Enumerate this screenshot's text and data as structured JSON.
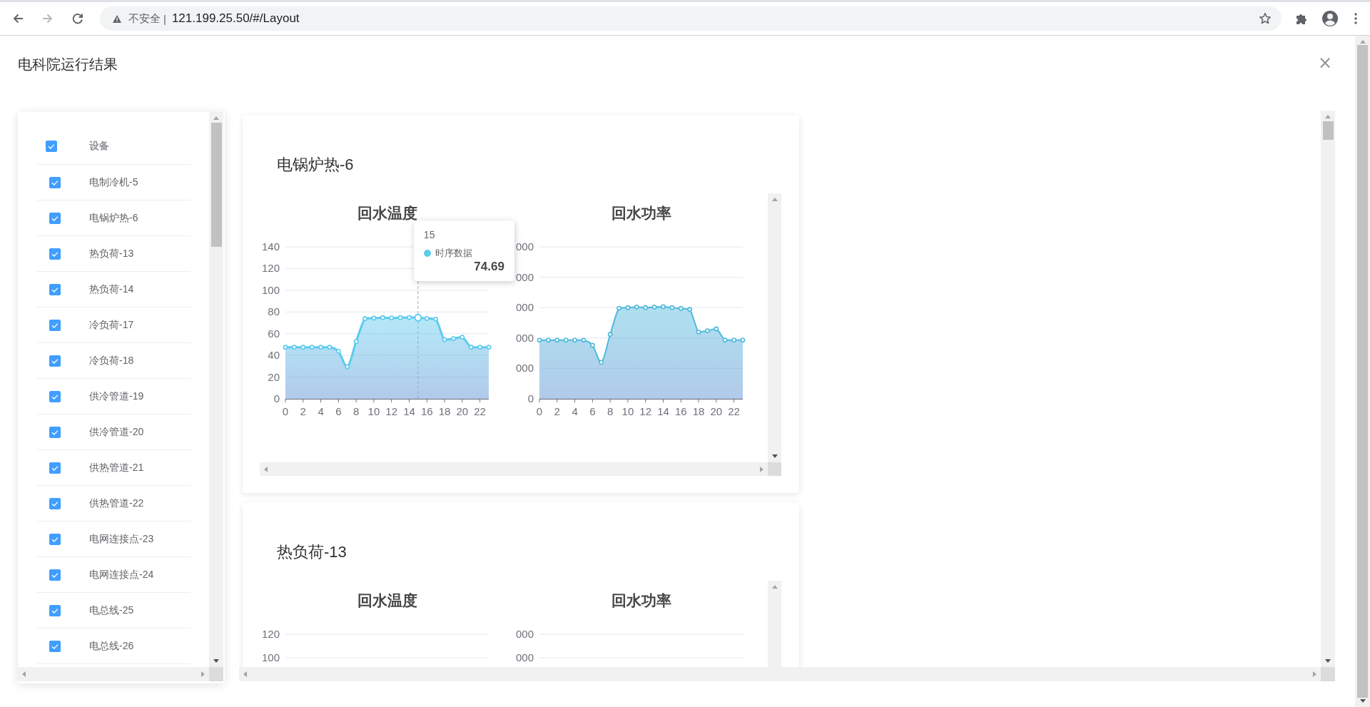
{
  "browser": {
    "nav_buttons": [
      {
        "kind": "back",
        "disabled": false
      },
      {
        "kind": "forward",
        "disabled": true
      },
      {
        "kind": "reload",
        "disabled": false
      }
    ],
    "security_label": "不安全",
    "separator": "|",
    "url": "121.199.25.50/#/Layout"
  },
  "dialog": {
    "title": "电科院运行结果",
    "close": "×"
  },
  "device_table": {
    "header": {
      "label": "设备",
      "checked": true
    },
    "rows": [
      {
        "label": "电制冷机-5",
        "checked": true
      },
      {
        "label": "电锅炉热-6",
        "checked": true
      },
      {
        "label": "热负荷-13",
        "checked": true
      },
      {
        "label": "热负荷-14",
        "checked": true
      },
      {
        "label": "冷负荷-17",
        "checked": true
      },
      {
        "label": "冷负荷-18",
        "checked": true
      },
      {
        "label": "供冷管道-19",
        "checked": true
      },
      {
        "label": "供冷管道-20",
        "checked": true
      },
      {
        "label": "供热管道-21",
        "checked": true
      },
      {
        "label": "供热管道-22",
        "checked": true
      },
      {
        "label": "电网连接点-23",
        "checked": true
      },
      {
        "label": "电网连接点-24",
        "checked": true
      },
      {
        "label": "电总线-25",
        "checked": true
      },
      {
        "label": "电总线-26",
        "checked": true
      }
    ]
  },
  "cards": [
    {
      "title": "电锅炉热-6",
      "charts": [
        {
          "title": "回水温度",
          "tooltip": {
            "title": "15",
            "value": "74.69"
          },
          "chart_data": {
            "type": "area",
            "grid": true,
            "x": [
              0,
              1,
              2,
              3,
              4,
              5,
              6,
              7,
              8,
              9,
              10,
              11,
              12,
              13,
              14,
              15,
              16,
              17,
              18,
              19,
              20,
              21,
              22,
              23
            ],
            "xlim": [
              0,
              23
            ],
            "xticks": [
              0,
              2,
              4,
              6,
              8,
              10,
              12,
              14,
              16,
              18,
              20,
              22
            ],
            "ylim": [
              0,
              140
            ],
            "yticks": [
              0,
              20,
              40,
              60,
              80,
              100,
              120,
              140
            ],
            "series": [
              {
                "name": "时序数据",
                "color": "#5ccbee",
                "values": [
                  47.5,
                  47.5,
                  47.5,
                  47.5,
                  47.5,
                  47.5,
                  43.8,
                  29.5,
                  52.8,
                  73.8,
                  74.3,
                  74.8,
                  74.5,
                  74.8,
                  74.9,
                  74.7,
                  74,
                  73.4,
                  54.5,
                  55.5,
                  56.8,
                  47.5,
                  47.5,
                  47.5
                ]
              }
            ],
            "ref_lines": [
              {
                "axis": "x",
                "value": 15
              }
            ]
          }
        },
        {
          "title": "回水功率",
          "y_axis_labels": [
            "000",
            "000",
            "000",
            "000",
            "000",
            "0"
          ],
          "x_axis_labels": [
            "0",
            "2",
            "4",
            "6",
            "8",
            "10",
            "12",
            "14",
            "16",
            "18",
            "20",
            "22"
          ]
        }
      ]
    },
    {
      "title": "热负荷-13",
      "charts": [
        {
          "title": "回水温度",
          "y_axis_labels": [
            "120",
            "100"
          ]
        },
        {
          "title": "回水功率",
          "y_axis_labels": [
            "000",
            "000"
          ]
        }
      ]
    }
  ]
}
